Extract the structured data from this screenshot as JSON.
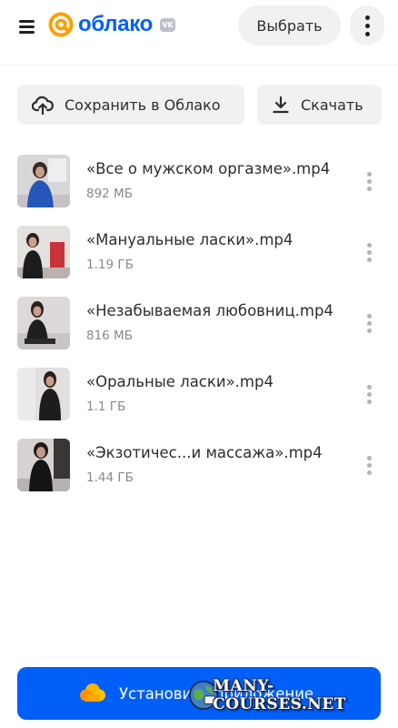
{
  "header": {
    "logo_text": "облако",
    "vk_badge": "VK",
    "select_label": "Выбрать",
    "icons": [
      "burger-menu-icon",
      "more-vertical-icon"
    ]
  },
  "actions": {
    "save_label": "Сохранить в Облако",
    "download_label": "Скачать"
  },
  "files": [
    {
      "name": "«Все о мужском оргазме».mp4",
      "size": "892 МБ"
    },
    {
      "name": "«Мануальные ласки».mp4",
      "size": "1.19 ГБ"
    },
    {
      "name": "«Незабываемая любовниц.mp4",
      "size": "816 МБ"
    },
    {
      "name": "«Оральные ласки».mp4",
      "size": "1.1 ГБ"
    },
    {
      "name": "«Экзотичес...и массажа».mp4",
      "size": "1.44 ГБ"
    }
  ],
  "install": {
    "label": "Установить приложение"
  },
  "watermark": {
    "text": "MANY-COURSES.NET"
  },
  "colors": {
    "brand": "#005ff9",
    "button_bg": "#f0f1f3",
    "secondary_text": "#87898f"
  }
}
